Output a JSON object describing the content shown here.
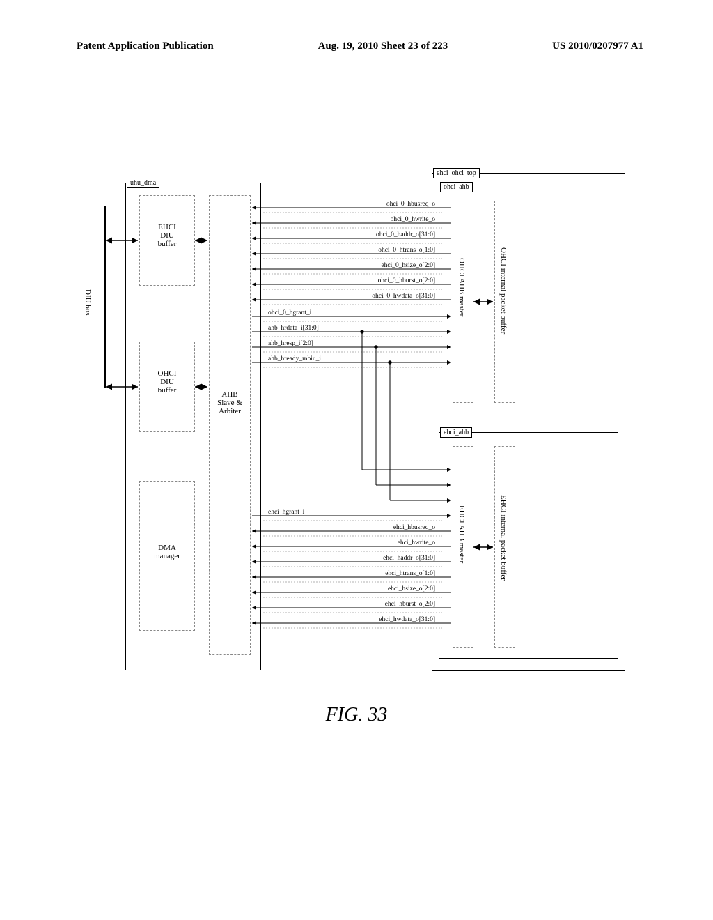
{
  "header": {
    "left": "Patent Application Publication",
    "center": "Aug. 19, 2010  Sheet 23 of 223",
    "right": "US 2010/0207977 A1"
  },
  "caption": "FIG. 33",
  "blocks": {
    "uhu_dma_tab": "uhu_dma",
    "ehci_diu_buffer": "EHCI\nDIU\nbuffer",
    "ohci_diu_buffer": "OHCI\nDIU\nbuffer",
    "dma_manager": "DMA\nmanager",
    "ahb_slave": "AHB\nSlave &\nArbiter",
    "diu_bus": "DIU bus",
    "ehci_ohci_top_tab": "ehci_ohci_top",
    "ohci_ahb_tab": "ohci_ahb",
    "ohci_ahb_master": "OHCI AHB master",
    "ohci_pkt_buffer": "OHCI internal packet buffer",
    "ehci_ahb_tab": "ehci_ahb",
    "ehci_ahb_master": "EHCI AHB master",
    "ehci_pkt_buffer": "EHCI internal packet buffer"
  },
  "signals_ohci_out": [
    "ohci_0_hbusreq_o",
    "ohci_0_hwrite_o",
    "ohci_0_haddr_o[31:0]",
    "ohci_0_htrans_o[1:0]",
    "ehci_0_hsize_o[2:0]",
    "ohci_0_hburst_o[2:0]",
    "ohci_0_hwdata_o[31:0]"
  ],
  "signals_shared": [
    "ohci_0_hgrant_i",
    "ahb_hrdata_i[31:0]",
    "ahb_hresp_i[2:0]",
    "ahb_hready_mbiu_i"
  ],
  "signals_ehci_in": [
    "ehci_hgrant_i"
  ],
  "signals_ehci_out": [
    "ehci_hbusreq_o",
    "ehci_hwrite_o",
    "ehci_haddr_o[31:0]",
    "ehci_htrans_o[1:0]",
    "ehci_hsize_o[2:0]",
    "ehci_hburst_o[2:0]",
    "ehci_hwdata_o[31:0]"
  ]
}
